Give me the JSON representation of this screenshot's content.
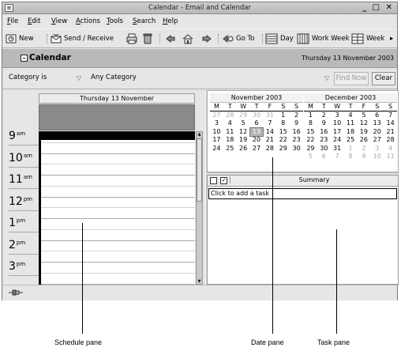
{
  "window": {
    "title": "Calendar - Email and Calendar",
    "sys_menu_glyph": "≡",
    "controls": "_ □ ✕"
  },
  "menubar": {
    "items": [
      {
        "label": "File",
        "mnemonic": "F",
        "rest": "ile"
      },
      {
        "label": "Edit",
        "mnemonic": "E",
        "rest": "dit"
      },
      {
        "label": "View",
        "mnemonic": "V",
        "rest": "iew"
      },
      {
        "label": "Actions",
        "mnemonic": "A",
        "rest": "ctions"
      },
      {
        "label": "Tools",
        "mnemonic": "T",
        "rest": "ools"
      },
      {
        "label": "Search",
        "mnemonic": "S",
        "rest": "earch"
      },
      {
        "label": "Help",
        "mnemonic": "H",
        "rest": "elp"
      }
    ]
  },
  "toolbar": {
    "new_label": "New",
    "send_receive_label": "Send / Receive",
    "goto_label": "Go To",
    "day_label": "Day",
    "work_week_label": "Work Week",
    "week_label": "Week",
    "more_glyph": "▸",
    "icons": [
      "new-icon",
      "send-receive-icon",
      "print-icon",
      "delete-icon",
      "back-icon",
      "home-icon",
      "forward-icon",
      "goto-icon",
      "day-view-icon",
      "work-week-view-icon",
      "week-view-icon"
    ]
  },
  "header": {
    "title": "Calendar",
    "date": "Thursday 13 November 2003"
  },
  "search": {
    "filter_field": "Category is",
    "filter_value": "Any Category",
    "find_now_label": "Find Now",
    "clear_label": "Clear",
    "arrow_glyph": "▽"
  },
  "schedule": {
    "day_heading": "Thursday 13 November",
    "hours": [
      {
        "hour": "9",
        "suffix": "am"
      },
      {
        "hour": "10",
        "suffix": "am"
      },
      {
        "hour": "11",
        "suffix": "am"
      },
      {
        "hour": "12",
        "suffix": "pm"
      },
      {
        "hour": "1",
        "suffix": "pm"
      },
      {
        "hour": "2",
        "suffix": "pm"
      },
      {
        "hour": "3",
        "suffix": "pm"
      }
    ],
    "scroll_up_glyph": "▲",
    "scroll_down_glyph": "▼"
  },
  "date_navigator": {
    "months": [
      {
        "title": "November 2003",
        "weekdays": [
          "M",
          "T",
          "W",
          "T",
          "F",
          "S",
          "S"
        ],
        "weeks": [
          [
            {
              "d": "27",
              "o": true
            },
            {
              "d": "28",
              "o": true
            },
            {
              "d": "29",
              "o": true
            },
            {
              "d": "30",
              "o": true
            },
            {
              "d": "31",
              "o": true
            },
            {
              "d": "1"
            },
            {
              "d": "2"
            }
          ],
          [
            {
              "d": "3"
            },
            {
              "d": "4"
            },
            {
              "d": "5"
            },
            {
              "d": "6"
            },
            {
              "d": "7"
            },
            {
              "d": "8"
            },
            {
              "d": "9"
            }
          ],
          [
            {
              "d": "10"
            },
            {
              "d": "11"
            },
            {
              "d": "12"
            },
            {
              "d": "13",
              "t": true
            },
            {
              "d": "14"
            },
            {
              "d": "15"
            },
            {
              "d": "16"
            }
          ],
          [
            {
              "d": "17"
            },
            {
              "d": "18"
            },
            {
              "d": "19"
            },
            {
              "d": "20"
            },
            {
              "d": "21"
            },
            {
              "d": "22"
            },
            {
              "d": "23"
            }
          ],
          [
            {
              "d": "24"
            },
            {
              "d": "25"
            },
            {
              "d": "26"
            },
            {
              "d": "27"
            },
            {
              "d": "28"
            },
            {
              "d": "29"
            },
            {
              "d": "30"
            }
          ]
        ]
      },
      {
        "title": "December 2003",
        "weekdays": [
          "M",
          "T",
          "W",
          "T",
          "F",
          "S",
          "S"
        ],
        "weeks": [
          [
            {
              "d": "1"
            },
            {
              "d": "2"
            },
            {
              "d": "3"
            },
            {
              "d": "4"
            },
            {
              "d": "5"
            },
            {
              "d": "6"
            },
            {
              "d": "7"
            }
          ],
          [
            {
              "d": "8"
            },
            {
              "d": "9"
            },
            {
              "d": "10"
            },
            {
              "d": "11"
            },
            {
              "d": "12"
            },
            {
              "d": "13"
            },
            {
              "d": "14"
            }
          ],
          [
            {
              "d": "15"
            },
            {
              "d": "16"
            },
            {
              "d": "17"
            },
            {
              "d": "18"
            },
            {
              "d": "19"
            },
            {
              "d": "20"
            },
            {
              "d": "21"
            }
          ],
          [
            {
              "d": "22"
            },
            {
              "d": "23"
            },
            {
              "d": "24"
            },
            {
              "d": "25"
            },
            {
              "d": "26"
            },
            {
              "d": "27"
            },
            {
              "d": "28"
            }
          ],
          [
            {
              "d": "29"
            },
            {
              "d": "30"
            },
            {
              "d": "31"
            },
            {
              "d": "1",
              "o": true
            },
            {
              "d": "2",
              "o": true
            },
            {
              "d": "3",
              "o": true
            },
            {
              "d": "4",
              "o": true
            }
          ],
          [
            {
              "d": "5",
              "o": true
            },
            {
              "d": "6",
              "o": true
            },
            {
              "d": "7",
              "o": true
            },
            {
              "d": "8",
              "o": true
            },
            {
              "d": "9",
              "o": true
            },
            {
              "d": "10",
              "o": true
            },
            {
              "d": "11",
              "o": true
            }
          ]
        ]
      }
    ]
  },
  "tasks": {
    "column_summary": "Summary",
    "complete_glyph": "✓",
    "add_task_placeholder": "Click to add a task"
  },
  "callouts": {
    "schedule_pane": "Schedule pane",
    "date_pane": "Date pane",
    "task_pane": "Task pane"
  },
  "colors": {
    "header_bg": "#b9b9b9",
    "long_event_bg": "#8a8a8a",
    "selection": "#000000",
    "today_cell": "#b4b4b4"
  }
}
